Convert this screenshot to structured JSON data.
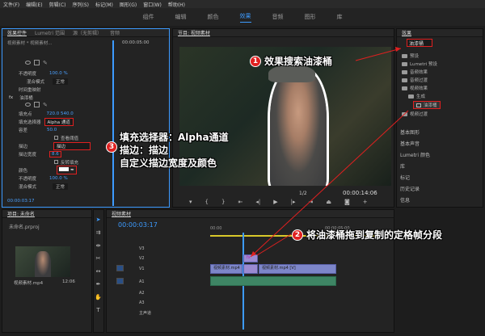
{
  "menu": [
    "文件(F)",
    "编辑(E)",
    "剪辑(C)",
    "序列(S)",
    "标记(M)",
    "图形(G)",
    "窗口(W)",
    "帮助(H)"
  ],
  "workspaces": [
    "组件",
    "编辑",
    "颜色",
    "效果",
    "音频",
    "图形",
    "库"
  ],
  "effect_controls": {
    "tabs": [
      "效果控件",
      "Lumetri 范围",
      "源（无剪辑）",
      "音频"
    ],
    "clip_title": "视频素材 * 视频素材...",
    "timecode": "00:00:05:00",
    "bottom_time": "00:00:03:17",
    "rows": [
      {
        "label": "不透明度",
        "value": "100.0 %"
      },
      {
        "label": "混合模式",
        "value": "正常"
      },
      {
        "label": "时间重映射",
        "value": ""
      },
      {
        "label": "油漆桶",
        "value": ""
      },
      {
        "label": "填充点",
        "value": "720.0   540.0"
      },
      {
        "label": "填充选择器",
        "value": "Alpha 通道"
      },
      {
        "label": "容差",
        "value": "50.0"
      },
      {
        "label": "查看阈值",
        "value": ""
      },
      {
        "label": "描边",
        "value": "描边"
      },
      {
        "label": "描边宽度",
        "value": "8.6"
      },
      {
        "label": "反转填充",
        "value": ""
      },
      {
        "label": "颜色",
        "value": ""
      },
      {
        "label": "不透明度",
        "value": "100.0 %"
      },
      {
        "label": "混合模式",
        "value": "正常"
      }
    ]
  },
  "program": {
    "tab": "节目: 视频素材",
    "fit": "1/2",
    "duration": "00:00:14:06"
  },
  "effects_panel": {
    "title": "效果",
    "search_value": "油漆桶",
    "tree": [
      "预设",
      "Lumetri 预设",
      "音频效果",
      "音频过渡",
      "视频效果",
      "生成",
      "油漆桶",
      "视频过渡"
    ],
    "sections": [
      "基本图形",
      "基本声音",
      "Lumetri 颜色",
      "库",
      "标记",
      "历史记录",
      "信息"
    ]
  },
  "project": {
    "tab": "项目: 未命名",
    "file": "未命名.prproj",
    "item_name": "视频素材.mp4",
    "item_duration": "12:06"
  },
  "timeline": {
    "tab": "视频素材",
    "timecode": "00:00:03:17",
    "ruler": [
      "00:00",
      "00:00:05:00"
    ],
    "tracks": [
      "V3",
      "V2",
      "V1",
      "A1",
      "A2",
      "A3",
      "主声道"
    ],
    "clip_fx": "fx",
    "clip1": "视频素材.mp4",
    "clip2": "视频素材.mp4 [V]"
  },
  "annotations": {
    "a1": "效果搜索油漆桶",
    "a2": "将油漆桶拖到复制的定格帧分段",
    "a3_lines": [
      "填充选择器：Alpha通道",
      "描边：描边",
      "自定义描边宽度及颜色"
    ],
    "n1": "1",
    "n2": "2",
    "n3": "3"
  },
  "colors": {
    "accent": "#3d9bff",
    "annotation_red": "#e02020",
    "clip_video": "#7d86c9",
    "clip_audio": "#3e8564"
  }
}
